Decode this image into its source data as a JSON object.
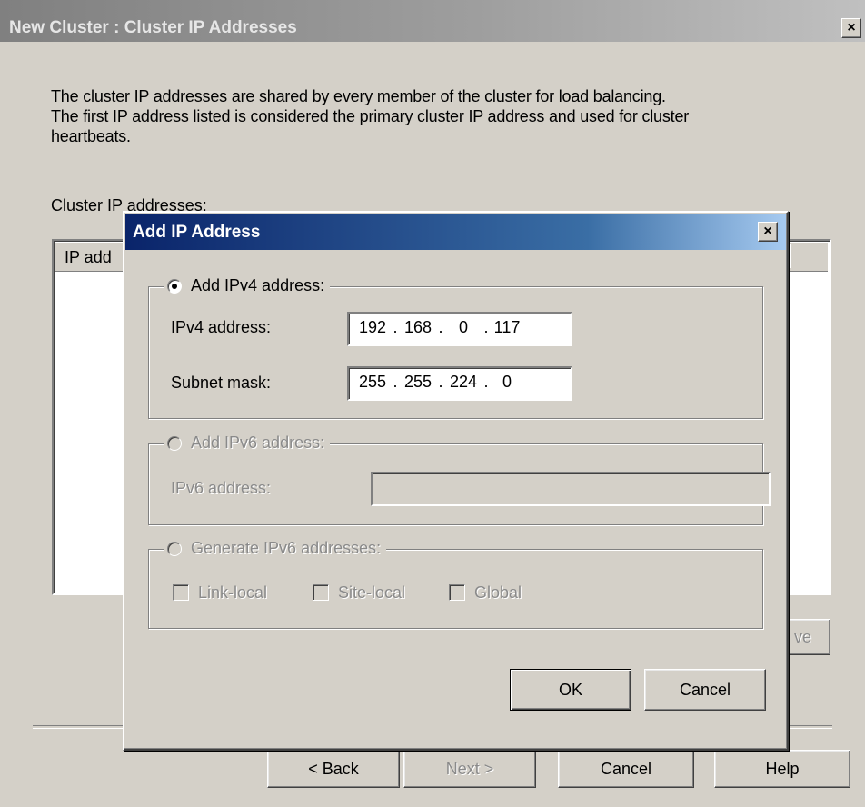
{
  "outer_window": {
    "title": "New Cluster : Cluster IP Addresses",
    "close_glyph": "×",
    "description": [
      "The cluster IP addresses are shared by every member of the cluster for load balancing.",
      "The first IP address listed is considered the primary cluster IP address and used for cluster",
      "heartbeats."
    ],
    "list_label": "Cluster IP addresses:",
    "list_column_header": "IP add",
    "remove_button_partial": "ve",
    "buttons": {
      "back": "< Back",
      "next": "Next >",
      "cancel": "Cancel",
      "help": "Help"
    }
  },
  "dialog": {
    "title": "Add IP Address",
    "close_glyph": "×",
    "ipv4_group": {
      "label": "Add IPv4 address:",
      "selected": true,
      "address_label": "IPv4 address:",
      "address_octets": [
        "192",
        "168",
        "0",
        "117"
      ],
      "subnet_label": "Subnet mask:",
      "subnet_octets": [
        "255",
        "255",
        "224",
        "0"
      ]
    },
    "ipv6_group": {
      "label": "Add IPv6 address:",
      "selected": false,
      "address_label": "IPv6 address:",
      "address_value": ""
    },
    "generate_group": {
      "label": "Generate IPv6 addresses:",
      "selected": false,
      "checkboxes": [
        "Link-local",
        "Site-local",
        "Global"
      ]
    },
    "buttons": {
      "ok": "OK",
      "cancel": "Cancel"
    }
  },
  "colors": {
    "window_bg": "#d4d0c8",
    "active_title_start": "#0a246a",
    "active_title_end": "#a6caf0",
    "inactive_title_start": "#808080",
    "disabled_text": "#8a8a8a"
  }
}
